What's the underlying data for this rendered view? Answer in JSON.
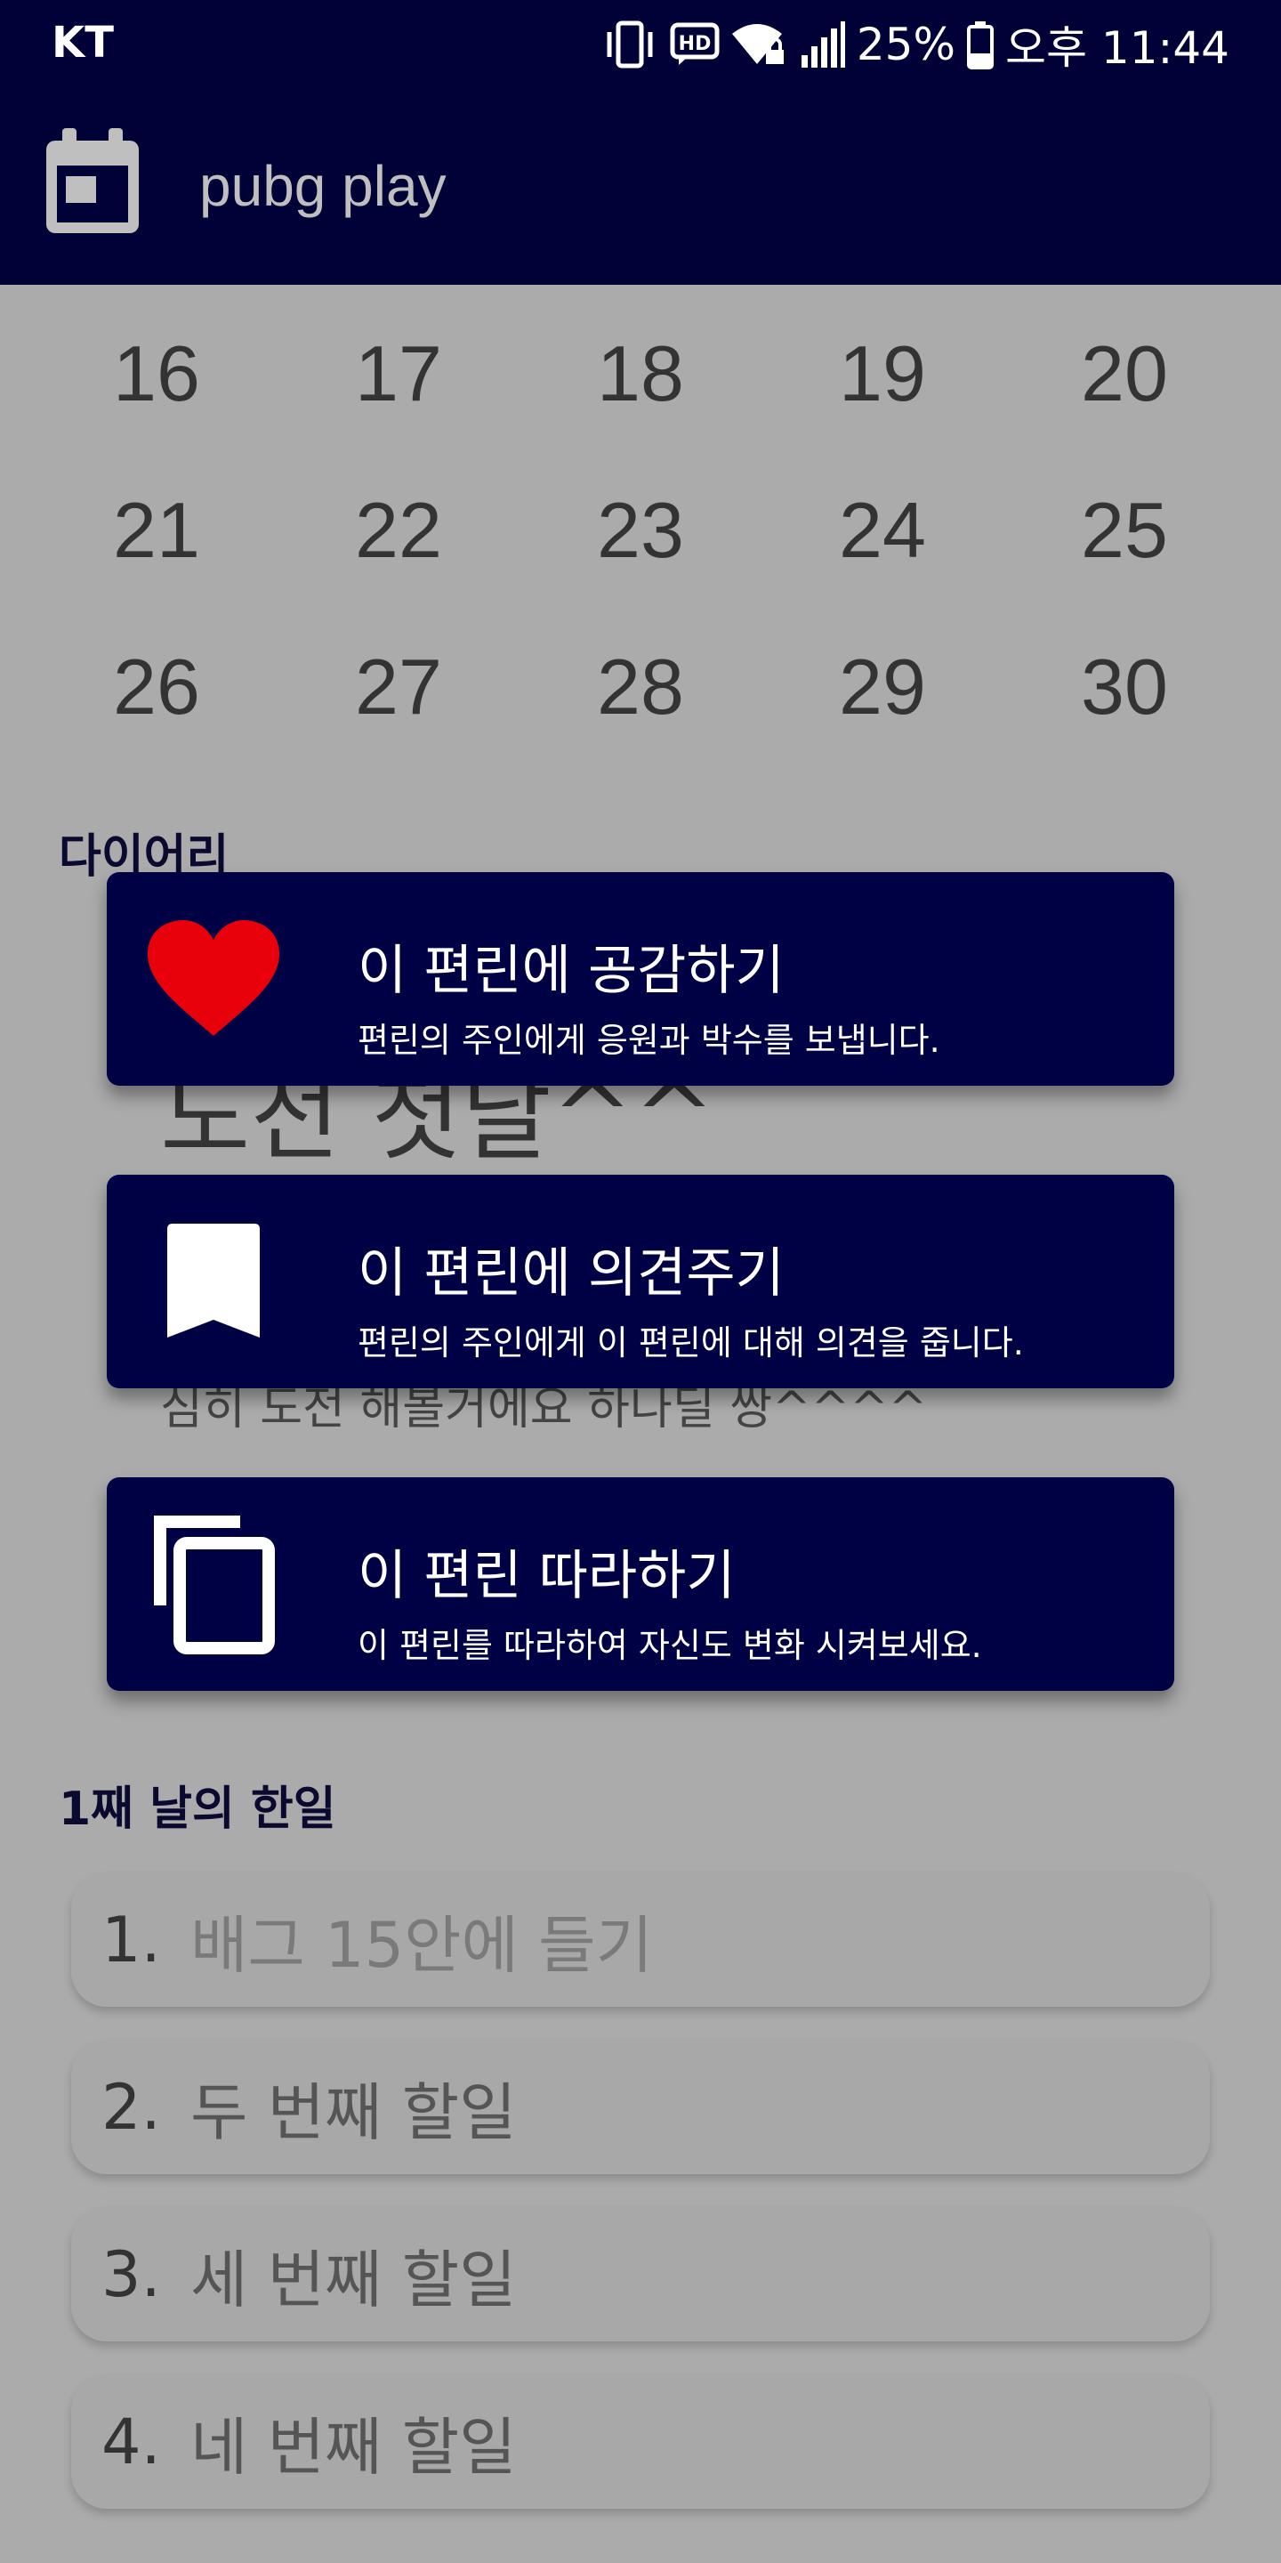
{
  "status_bar": {
    "carrier": "KT",
    "battery": "25%",
    "time": "오후 11:44",
    "icons": [
      "vibrate-icon",
      "hd-icon",
      "wifi-lock-icon",
      "signal-icon",
      "battery-icon"
    ]
  },
  "app_bar": {
    "title": "pubg play",
    "icon": "calendar-icon"
  },
  "calendar": {
    "rows": [
      [
        "16",
        "17",
        "18",
        "19",
        "20"
      ],
      [
        "21",
        "22",
        "23",
        "24",
        "25"
      ],
      [
        "26",
        "27",
        "28",
        "29",
        "30"
      ]
    ]
  },
  "diary": {
    "label": "다이어리",
    "title": "도전 첫날^^",
    "body": "심히 도전 해볼거에요 하나딜 쌍^^^^"
  },
  "actions": [
    {
      "icon": "heart-icon",
      "title": "이 편린에 공감하기",
      "subtitle": "편린의 주인에게 응원과 박수를 보냅니다."
    },
    {
      "icon": "bookmark-icon",
      "title": "이 편린에 의견주기",
      "subtitle": "편린의 주인에게 이 편린에 대해 의견을 줍니다."
    },
    {
      "icon": "copy-icon",
      "title": "이 편린 따라하기",
      "subtitle": "이 편린를 따라하여 자신도 변화 시켜보세요."
    }
  ],
  "todos": {
    "label": "1째 날의 한일",
    "items": [
      {
        "number": "1.",
        "text": "배그 15안에 들기"
      },
      {
        "number": "2.",
        "text": "두 번째 할일"
      },
      {
        "number": "3.",
        "text": "세 번째 할일"
      },
      {
        "number": "4.",
        "text": "네 번째 할일"
      }
    ]
  },
  "colors": {
    "primary_dark": "#000137",
    "card_bg": "#000044",
    "scrim_bg": "#ababab",
    "heart": "#e8000b"
  }
}
